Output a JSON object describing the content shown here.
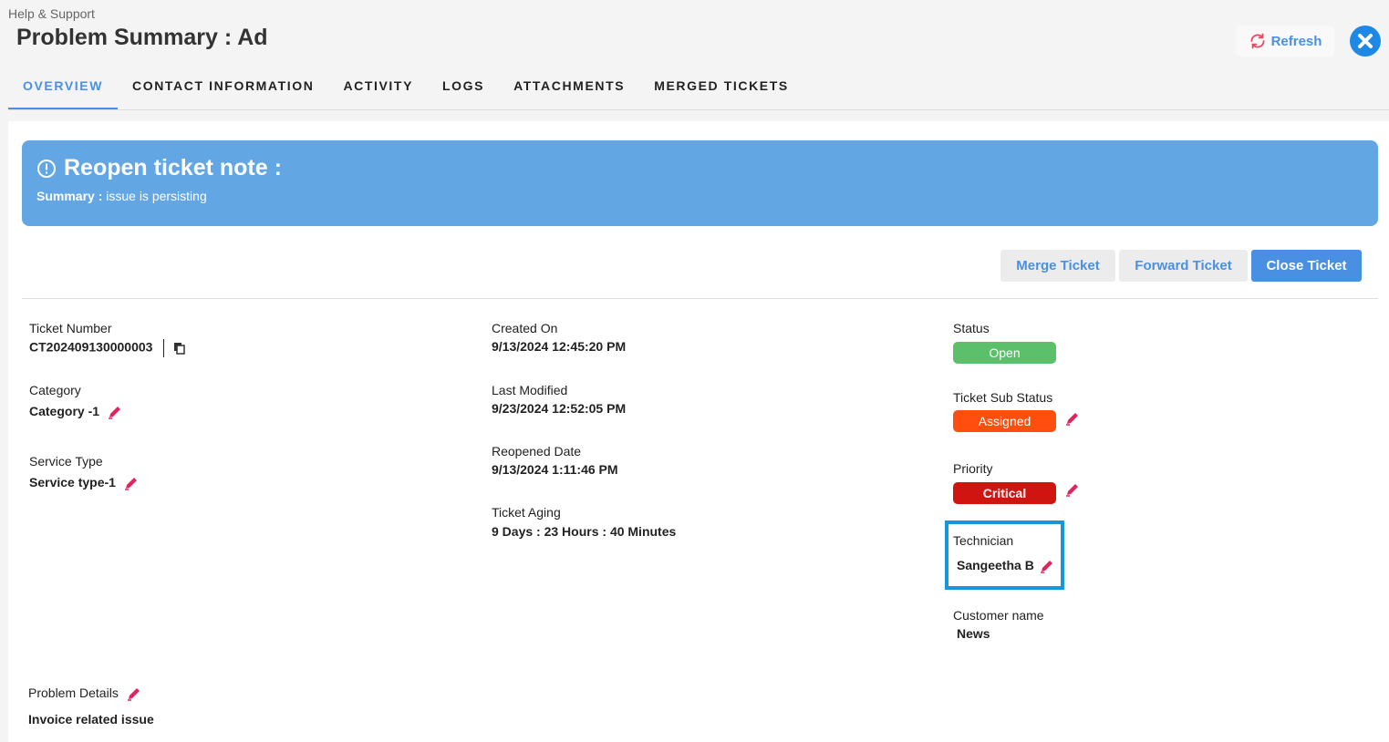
{
  "header": {
    "breadcrumb": "Help & Support",
    "title": "Problem Summary : Ad",
    "refresh_label": "Refresh"
  },
  "tabs": [
    {
      "label": "OVERVIEW",
      "active": true
    },
    {
      "label": "CONTACT INFORMATION"
    },
    {
      "label": "ACTIVITY"
    },
    {
      "label": "LOGS"
    },
    {
      "label": "ATTACHMENTS"
    },
    {
      "label": "MERGED TICKETS"
    }
  ],
  "banner": {
    "title": "Reopen ticket note :",
    "summary_label": "Summary :",
    "summary_text": "issue is persisting"
  },
  "actions": {
    "merge": "Merge Ticket",
    "forward": "Forward Ticket",
    "close": "Close Ticket"
  },
  "details": {
    "ticket_number_label": "Ticket Number",
    "ticket_number": "CT202409130000003",
    "category_label": "Category",
    "category": "Category -1",
    "service_type_label": "Service Type",
    "service_type": "Service type-1",
    "created_on_label": "Created On",
    "created_on": "9/13/2024 12:45:20 PM",
    "last_modified_label": "Last Modified",
    "last_modified": "9/23/2024 12:52:05 PM",
    "reopened_date_label": "Reopened Date",
    "reopened_date": "9/13/2024 1:11:46 PM",
    "ticket_aging_label": "Ticket Aging",
    "ticket_aging": "9 Days : 23 Hours : 40 Minutes",
    "status_label": "Status",
    "status": "Open",
    "sub_status_label": "Ticket Sub Status",
    "sub_status": "Assigned",
    "priority_label": "Priority",
    "priority": "Critical",
    "technician_label": "Technician",
    "technician": "Sangeetha B",
    "customer_label": "Customer name",
    "customer": "News",
    "problem_details_label": "Problem Details",
    "problem_details": "Invoice related issue"
  },
  "colors": {
    "accent": "#4a90e2",
    "banner": "#62a6e4",
    "status_open": "#5cbf6a",
    "sub_status_assigned": "#ff4e0d",
    "priority_critical": "#d0140f",
    "edit_icon": "#e0245e",
    "highlight_border": "#1597d9"
  }
}
